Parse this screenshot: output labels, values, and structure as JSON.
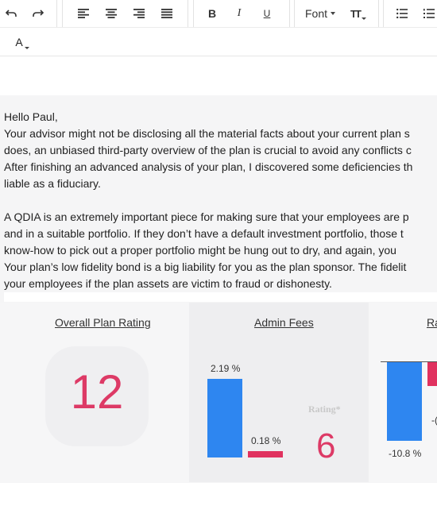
{
  "toolbar": {
    "undo_icon": "undo-icon",
    "redo_icon": "redo-icon",
    "bold_label": "B",
    "italic_label": "I",
    "underline_label": "U",
    "font_label": "Font",
    "text_size_label": "TT",
    "text_color_label": "A"
  },
  "email": {
    "greeting": "Hello Paul,",
    "lines": [
      "Your advisor might not be disclosing all the material facts about your current plan s",
      "does, an unbiased third-party overview of the plan is crucial to avoid any conflicts c",
      "After finishing an advanced analysis of your plan, I discovered some deficiencies th",
      "liable as a fiduciary."
    ],
    "lines2": [
      "A QDIA is an extremely important piece for making sure that your employees are p",
      "and in a suitable portfolio. If they don’t have a default investment portfolio, those t",
      "know-how to pick out a proper portfolio might be hung out to dry, and again, you",
      "Your plan’s low fidelity bond is a big liability for you as the plan sponsor. The fidelit",
      "your employees if the plan assets are victim to fraud or dishonesty."
    ]
  },
  "panels": {
    "overall": {
      "title": "Overall Plan Rating",
      "rating": "12"
    },
    "admin": {
      "title": "Admin Fees",
      "bar1_label": "2.19 %",
      "bar2_label": "0.18 %",
      "rating_caption": "Rating*",
      "rating": "6"
    },
    "returns": {
      "title": "Ra",
      "bar1_label": "-10.8 %",
      "bar2_label": "-("
    }
  },
  "colors": {
    "blue": "#2e86f0",
    "pink": "#e0325f",
    "rating_pink": "#dd3a66"
  }
}
